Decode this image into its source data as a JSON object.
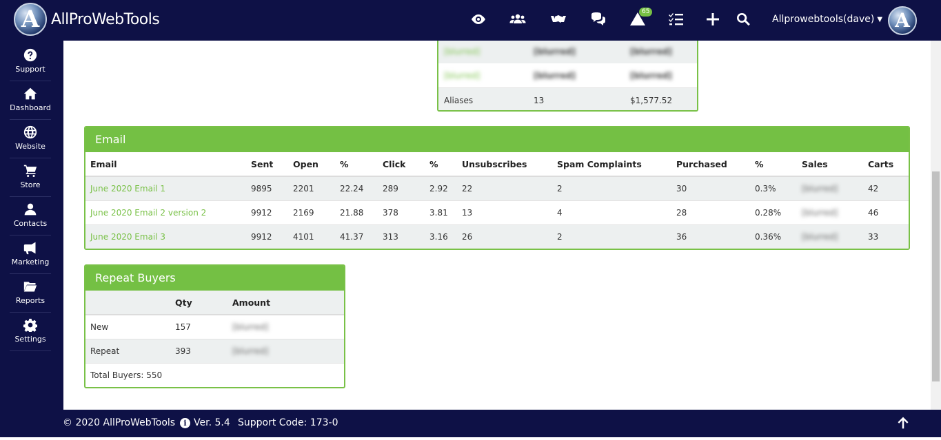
{
  "app": {
    "brand": "AllProWebTools",
    "user_label": "Allprowebtools(dave)"
  },
  "topbar": {
    "notifications_count": "65",
    "icons": [
      "eye-icon",
      "users-icon",
      "handshake-icon",
      "comments-icon",
      "alert-bell-icon",
      "checklist-icon",
      "plus-icon",
      "search-icon"
    ]
  },
  "sidebar": {
    "items": [
      {
        "label": "Support",
        "icon": "question-circle-icon"
      },
      {
        "label": "Dashboard",
        "icon": "home-icon"
      },
      {
        "label": "Website",
        "icon": "globe-icon"
      },
      {
        "label": "Store",
        "icon": "cart-icon"
      },
      {
        "label": "Contacts",
        "icon": "user-icon"
      },
      {
        "label": "Marketing",
        "icon": "megaphone-icon"
      },
      {
        "label": "Reports",
        "icon": "folder-icon"
      },
      {
        "label": "Settings",
        "icon": "gear-icon"
      }
    ]
  },
  "top_panel": {
    "rows": [
      {
        "name": "[blurred]",
        "qty": "[blurred]",
        "amount": "[blurred]"
      },
      {
        "name": "[blurred]",
        "qty": "[blurred]",
        "amount": "[blurred]"
      },
      {
        "name": "Aliases",
        "qty": "13",
        "amount": "$1,577.52"
      }
    ]
  },
  "email": {
    "title": "Email",
    "headers": [
      "Email",
      "Sent",
      "Open",
      "%",
      "Click",
      "%",
      "Unsubscribes",
      "Spam Complaints",
      "Purchased",
      "%",
      "Sales",
      "Carts"
    ],
    "rows": [
      {
        "email": "June 2020 Email 1",
        "sent": "9895",
        "open": "2201",
        "open_pct": "22.24",
        "click": "289",
        "click_pct": "2.92",
        "unsub": "22",
        "spam": "2",
        "purchased": "30",
        "purchased_pct": "0.3%",
        "sales": "[blurred]",
        "carts": "42"
      },
      {
        "email": "June 2020 Email 2 version 2",
        "sent": "9912",
        "open": "2169",
        "open_pct": "21.88",
        "click": "378",
        "click_pct": "3.81",
        "unsub": "13",
        "spam": "4",
        "purchased": "28",
        "purchased_pct": "0.28%",
        "sales": "[blurred]",
        "carts": "46"
      },
      {
        "email": "June 2020 Email 3",
        "sent": "9912",
        "open": "4101",
        "open_pct": "41.37",
        "click": "313",
        "click_pct": "3.16",
        "unsub": "26",
        "spam": "2",
        "purchased": "36",
        "purchased_pct": "0.36%",
        "sales": "[blurred]",
        "carts": "33"
      }
    ]
  },
  "repeat_buyers": {
    "title": "Repeat Buyers",
    "headers": [
      "",
      "Qty",
      "Amount"
    ],
    "rows": [
      {
        "label": "New",
        "qty": "157",
        "amount": "[blurred]"
      },
      {
        "label": "Repeat",
        "qty": "393",
        "amount": "[blurred]"
      }
    ],
    "total": "Total Buyers: 550"
  },
  "footer": {
    "copyright": "© 2020 AllProWebTools",
    "version": "Ver. 5.4",
    "support_code": "Support Code: 173-0"
  },
  "colors": {
    "navy": "#0e1146",
    "green": "#74c044",
    "row_gray": "#edf0f0"
  }
}
